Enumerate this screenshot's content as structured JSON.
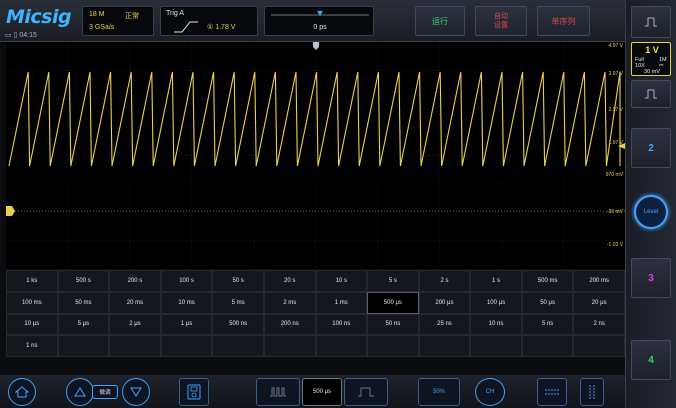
{
  "header": {
    "logo": "Micsig",
    "clock": "04:15",
    "acquisition": {
      "memory": "18 M",
      "mode": "正常",
      "sample_rate": "3 GSa/s"
    },
    "trigger": {
      "title": "Trig A",
      "level": "① 1.78 V"
    },
    "time_position": "0 ps",
    "buttons": {
      "run": "运行",
      "auto_setup": "自动\n设置",
      "single": "单序列"
    }
  },
  "channel1": {
    "scale": "1 V",
    "bandwidth": "Full",
    "impedance": "1M",
    "probe": "10X",
    "coupling": "⎓",
    "offset": "30 mV"
  },
  "scope": {
    "voltage_labels": [
      "4.97 V",
      "3.97 V",
      "2.97 V",
      "1.97 V",
      "970 mV",
      "-30 mV",
      "-1.03 V"
    ],
    "trace_color": "#e8d24a"
  },
  "right_panel": {
    "ch2": "2",
    "ch3": "3",
    "ch4": "4",
    "level": "Level"
  },
  "timebase": {
    "selected": "500 μs",
    "rows": [
      [
        "1 ks",
        "500 s",
        "200 s",
        "100 s",
        "50 s",
        "20 s",
        "10 s",
        "5 s",
        "2 s",
        "1 s",
        "500 ms",
        "200 ms"
      ],
      [
        "100 ms",
        "50 ms",
        "20 ms",
        "10 ms",
        "5 ms",
        "2 ms",
        "1 ms",
        "500 μs",
        "200 μs",
        "100 μs",
        "50 μs",
        "20 μs"
      ],
      [
        "10 μs",
        "5 μs",
        "2 μs",
        "1 μs",
        "500 ns",
        "200 ns",
        "100 ns",
        "50 ns",
        "25 ns",
        "10 ns",
        "5 ns",
        "2 ns"
      ],
      [
        "1 ns",
        "",
        "",
        "",
        "",
        "",
        "",
        "",
        "",
        "",
        "",
        ""
      ]
    ]
  },
  "bottom": {
    "fine": "微调",
    "timebase_value": "500 μs",
    "zoom": "50%",
    "ch_label": "CH"
  },
  "colors": {
    "accent": "#3fa4ff",
    "ch1": "#e8d24a",
    "run": "#36d66a",
    "stop": "#e04848",
    "ch3": "#e040e0",
    "ch4": "#36d66a",
    "ch2": "#3fa4ff"
  }
}
